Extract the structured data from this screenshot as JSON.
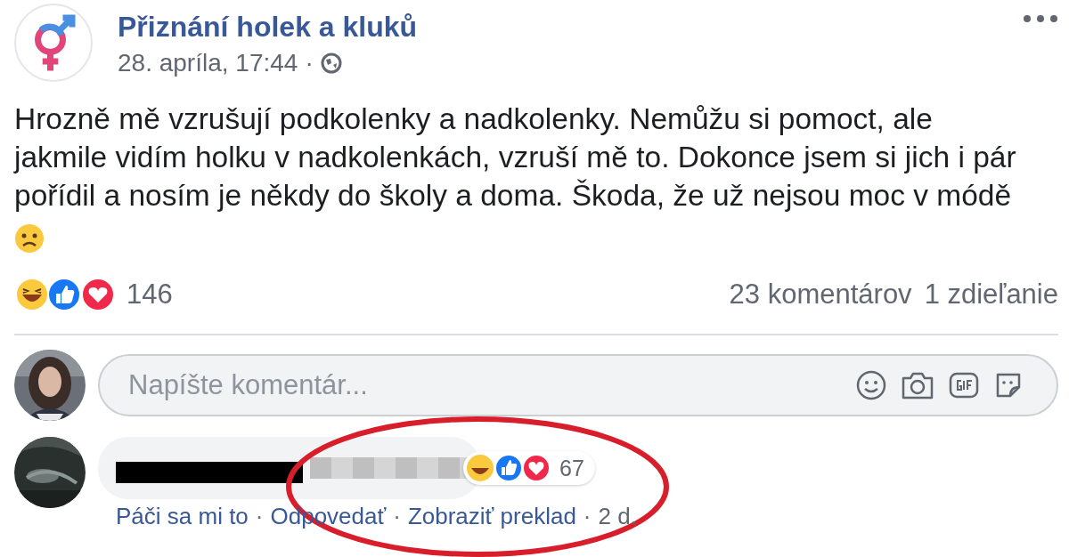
{
  "post": {
    "page_name": "Přiznání holek a kluků",
    "timestamp": "28. apríla, 17:44",
    "separator": "·",
    "text_lines": [
      "Hrozně mě vzrušují podkolenky a nadkolenky. Nemůžu si pomoct, ale",
      "jakmile vidím holku v nadkolenkách, vzruší mě to. Dokonce jsem si jich i pár",
      "pořídil a nosím je někdy do školy a doma. Škoda, že už nejsou moc v módě"
    ],
    "reaction_count": "146",
    "comments_count": "23 komentárov",
    "shares_count": "1 zdieľanie"
  },
  "composer": {
    "placeholder": "Napíšte komentár..."
  },
  "comments": [
    {
      "reaction_count": "67",
      "actions": [
        "Páči sa mi to",
        "Odpovedať",
        "Zobraziť preklad"
      ],
      "age": "2 d.",
      "separator": "·"
    }
  ]
}
